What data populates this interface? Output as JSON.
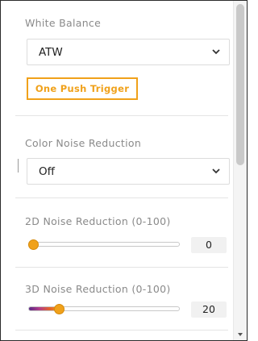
{
  "white_balance": {
    "label": "White Balance",
    "selected": "ATW",
    "trigger_label": "One Push Trigger"
  },
  "color_noise": {
    "label": "Color Noise Reduction",
    "selected": "Off"
  },
  "noise_2d": {
    "label": "2D Noise Reduction (0-100)",
    "value": "0",
    "level": 0
  },
  "noise_3d": {
    "label": "3D Noise Reduction (0-100)",
    "value": "20",
    "level": 20
  },
  "colors": {
    "accent": "#f0a11a",
    "text": "#222222",
    "label": "#8a8a8a"
  }
}
